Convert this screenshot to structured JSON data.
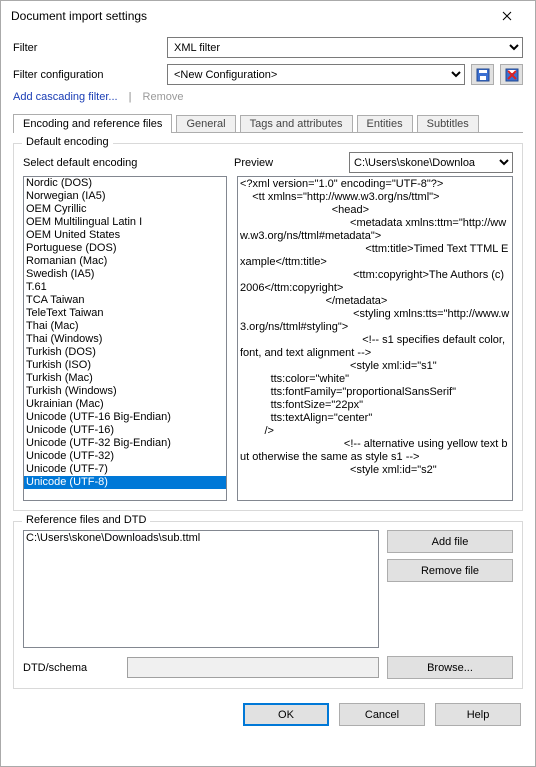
{
  "window": {
    "title": "Document import settings"
  },
  "filter": {
    "label": "Filter",
    "value": "XML filter",
    "config_label": "Filter configuration",
    "config_value": "<New Configuration>",
    "add_link": "Add cascading filter...",
    "remove_link": "Remove"
  },
  "icons": {
    "save": "save-icon",
    "delete": "delete-icon"
  },
  "tabs": {
    "t0": "Encoding and reference files",
    "t1": "General",
    "t2": "Tags and attributes",
    "t3": "Entities",
    "t4": "Subtitles"
  },
  "encoding": {
    "legend": "Default encoding",
    "select_label": "Select default encoding",
    "preview_label": "Preview",
    "preview_path": "C:\\Users\\skone\\Downloa",
    "items": {
      "i0": "Nordic (DOS)",
      "i1": "Norwegian (IA5)",
      "i2": "OEM Cyrillic",
      "i3": "OEM Multilingual Latin I",
      "i4": "OEM United States",
      "i5": "Portuguese (DOS)",
      "i6": "Romanian (Mac)",
      "i7": "Swedish (IA5)",
      "i8": "T.61",
      "i9": "TCA Taiwan",
      "i10": "TeleText Taiwan",
      "i11": "Thai (Mac)",
      "i12": "Thai (Windows)",
      "i13": "Turkish (DOS)",
      "i14": "Turkish (ISO)",
      "i15": "Turkish (Mac)",
      "i16": "Turkish (Windows)",
      "i17": "Ukrainian (Mac)",
      "i18": "Unicode (UTF-16 Big-Endian)",
      "i19": "Unicode (UTF-16)",
      "i20": "Unicode (UTF-32 Big-Endian)",
      "i21": "Unicode (UTF-32)",
      "i22": "Unicode (UTF-7)",
      "i23": "Unicode (UTF-8)"
    },
    "selected": "Unicode (UTF-8)",
    "preview_text": "<?xml version=\"1.0\" encoding=\"UTF-8\"?>\n    <tt xmlns=\"http://www.w3.org/ns/ttml\">\n                              <head>\n                                    <metadata xmlns:ttm=\"http://www.w3.org/ns/ttml#metadata\">\n                                         <ttm:title>Timed Text TTML Example</ttm:title>\n                                     <ttm:copyright>The Authors (c) 2006</ttm:copyright>\n                            </metadata>\n                                     <styling xmlns:tts=\"http://www.w3.org/ns/ttml#styling\">\n                                        <!-- s1 specifies default color, font, and text alignment -->\n                                    <style xml:id=\"s1\"\n          tts:color=\"white\"\n          tts:fontFamily=\"proportionalSansSerif\"\n          tts:fontSize=\"22px\"\n          tts:textAlign=\"center\"\n        />\n                                  <!-- alternative using yellow text but otherwise the same as style s1 -->\n                                    <style xml:id=\"s2\""
  },
  "reference": {
    "legend": "Reference files and DTD",
    "file0": "C:\\Users\\skone\\Downloads\\sub.ttml",
    "add_btn": "Add file",
    "remove_btn": "Remove file",
    "dtd_label": "DTD/schema",
    "browse_btn": "Browse..."
  },
  "buttons": {
    "ok": "OK",
    "cancel": "Cancel",
    "help": "Help"
  }
}
